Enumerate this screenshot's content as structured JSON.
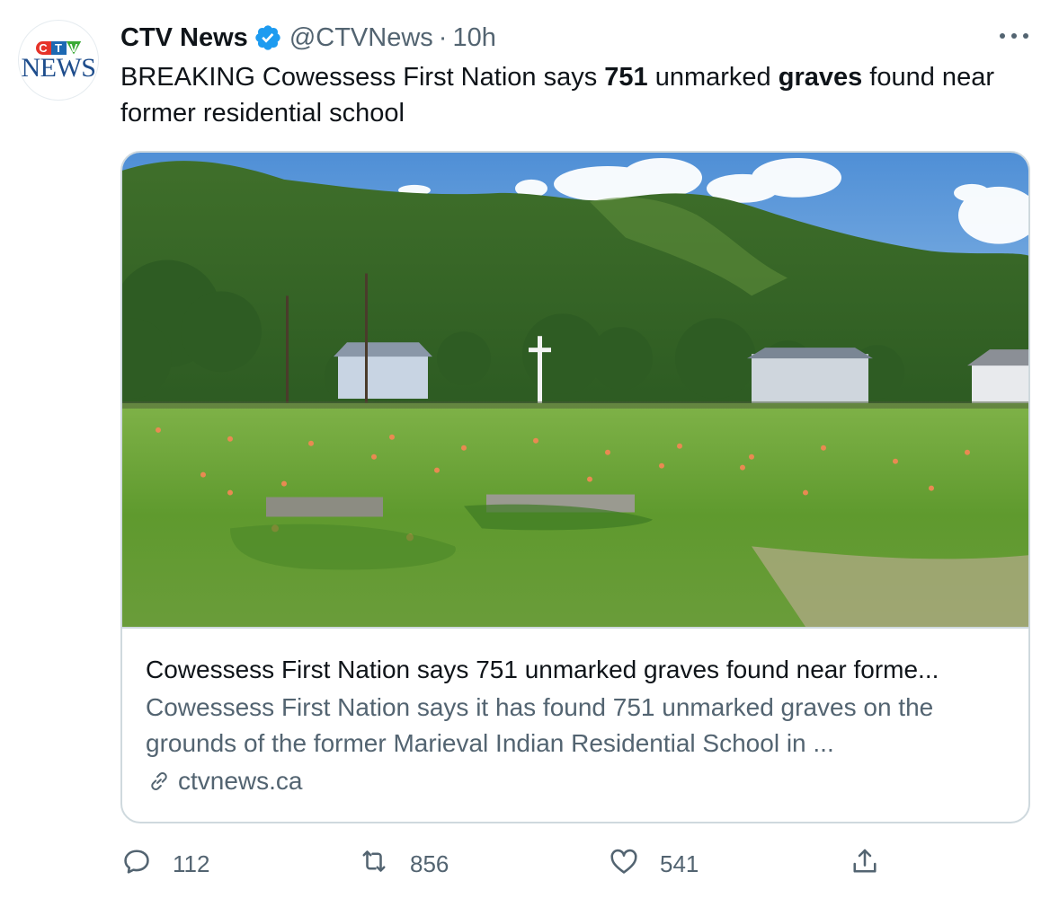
{
  "tweet": {
    "author_name": "CTV News",
    "handle": "@CTVNews",
    "separator": "·",
    "time": "10h",
    "avatar": {
      "logo_top": [
        "C",
        "T",
        "V"
      ],
      "logo_bottom": "NEWS"
    },
    "text": {
      "part1": "BREAKING Cowessess First Nation says ",
      "bold1": "751",
      "part2": " unmarked ",
      "bold2": "graves",
      "part3": " found near former residential school"
    }
  },
  "card": {
    "title": "Cowessess First Nation says 751 unmarked graves found near forme...",
    "description": "Cowessess First Nation says it has found 751 unmarked graves on the grounds of the former Marieval Indian Residential School in ...",
    "domain": "ctvnews.ca"
  },
  "actions": {
    "reply_count": "112",
    "retweet_count": "856",
    "like_count": "541"
  },
  "colors": {
    "verified": "#1d9bf0",
    "secondary_text": "#536471",
    "border": "#cfd9de"
  },
  "icons": [
    "verified-badge-icon",
    "more-icon",
    "link-icon",
    "reply-icon",
    "retweet-icon",
    "like-icon",
    "share-icon"
  ]
}
